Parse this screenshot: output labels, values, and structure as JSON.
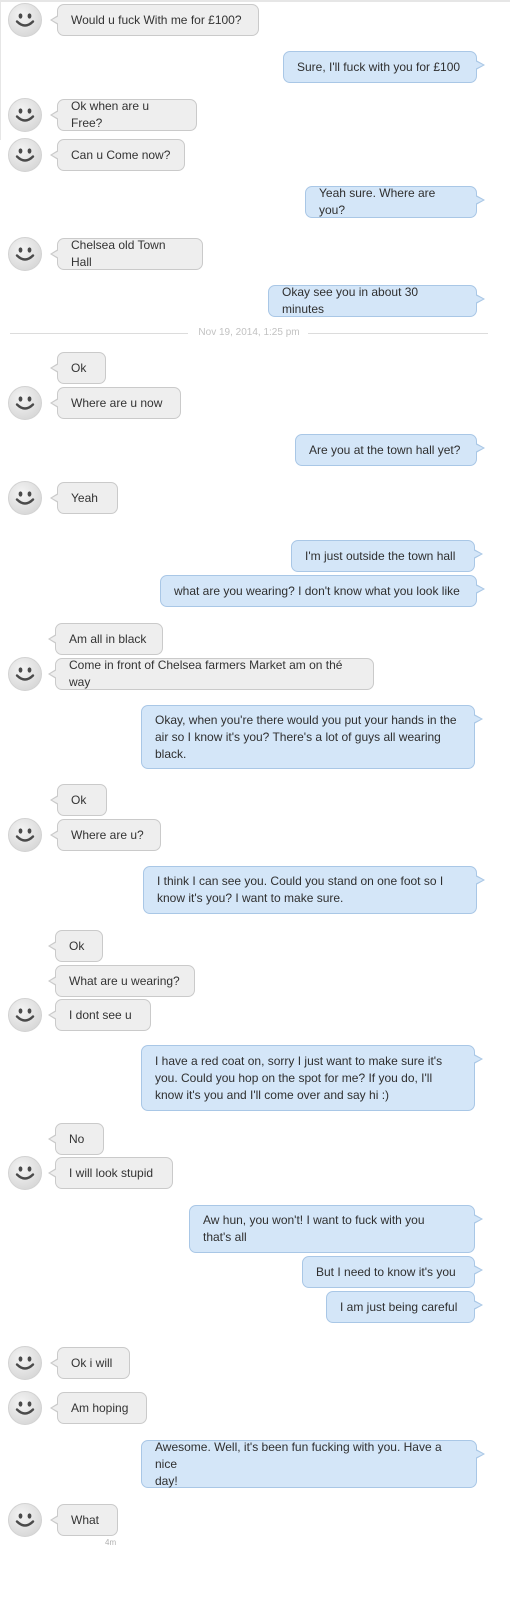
{
  "conversation": {
    "divider_timestamp": "Nov 19, 2014, 1:25 pm",
    "last_message_age": "4m",
    "colors": {
      "incoming_bubble": "#eeeeee",
      "incoming_border": "#cacaca",
      "outgoing_bubble": "#d4e6f8",
      "outgoing_border": "#a9c7e6",
      "background": "#ffffff"
    },
    "avatar_icon": "smiley-face-icon",
    "messages": [
      {
        "dir": "in",
        "text": "Would u fuck With me for £100?",
        "avatar": true
      },
      {
        "dir": "out",
        "text": "Sure, I'll fuck with you for £100"
      },
      {
        "dir": "in",
        "text": "Ok when are u Free?",
        "avatar": true
      },
      {
        "dir": "in",
        "text": "Can u Come now?",
        "avatar": true
      },
      {
        "dir": "out",
        "text": "Yeah sure. Where are you?"
      },
      {
        "dir": "in",
        "text": "Chelsea old Town Hall",
        "avatar": true
      },
      {
        "dir": "out",
        "text": "Okay see you in about 30 minutes"
      },
      {
        "dir": "in",
        "text": "Ok",
        "avatar": false
      },
      {
        "dir": "in",
        "text": "Where are u now",
        "avatar": true
      },
      {
        "dir": "out",
        "text": "Are you at the town hall yet?"
      },
      {
        "dir": "in",
        "text": "Yeah",
        "avatar": true
      },
      {
        "dir": "out",
        "text": "I'm just outside the town hall"
      },
      {
        "dir": "out",
        "text": "what are you wearing? I don't know what you look like"
      },
      {
        "dir": "in",
        "text": "Am all in black",
        "avatar": false
      },
      {
        "dir": "in",
        "text": "Come in front of Chelsea farmers Market am on thé way",
        "avatar": true
      },
      {
        "dir": "out",
        "text": "Okay, when you're there would you put your hands in the\nair so I know it's you? There's a lot of guys all wearing\nblack."
      },
      {
        "dir": "in",
        "text": "Ok",
        "avatar": false
      },
      {
        "dir": "in",
        "text": "Where are u?",
        "avatar": true
      },
      {
        "dir": "out",
        "text": "I think I can see you. Could you stand on one foot so I\nknow it's you? I want to make sure."
      },
      {
        "dir": "in",
        "text": "Ok",
        "avatar": false
      },
      {
        "dir": "in",
        "text": "What are u wearing?",
        "avatar": false
      },
      {
        "dir": "in",
        "text": "I dont see u",
        "avatar": true
      },
      {
        "dir": "out",
        "text": "I have a red coat on, sorry I just want to make sure it's\nyou. Could you hop on the spot for me? If you do, I'll\nknow it's you and I'll come over and say hi :)"
      },
      {
        "dir": "in",
        "text": "No",
        "avatar": false
      },
      {
        "dir": "in",
        "text": "I will look stupid",
        "avatar": true
      },
      {
        "dir": "out",
        "text": "Aw hun, you won't! I want to fuck with you\nthat's all"
      },
      {
        "dir": "out",
        "text": "But I need to know it's you"
      },
      {
        "dir": "out",
        "text": "I am just being careful"
      },
      {
        "dir": "in",
        "text": "Ok i will",
        "avatar": true
      },
      {
        "dir": "in",
        "text": "Am hoping",
        "avatar": true
      },
      {
        "dir": "out",
        "text": "Awesome. Well, it's been fun fucking with you. Have a nice\nday!"
      },
      {
        "dir": "in",
        "text": "What",
        "avatar": true
      }
    ]
  }
}
